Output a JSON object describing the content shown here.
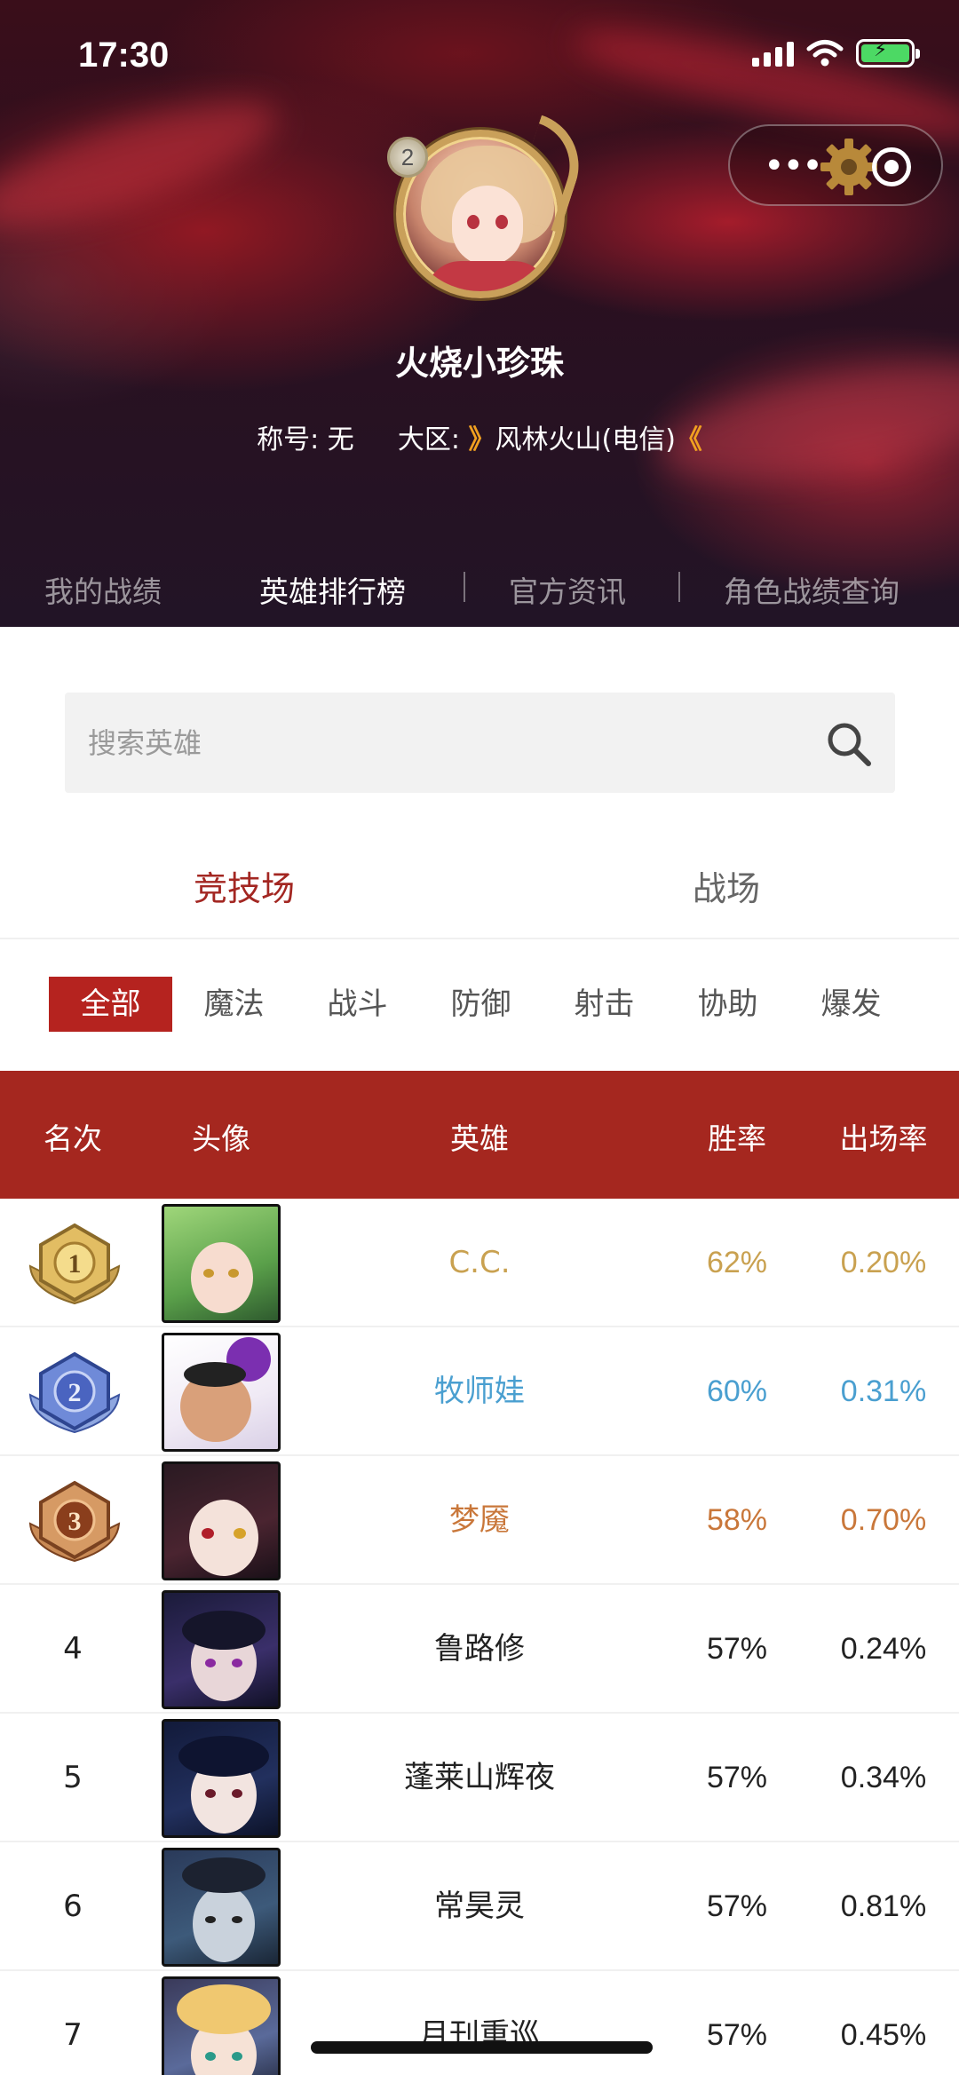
{
  "status": {
    "time": "17:30"
  },
  "profile": {
    "level": "2",
    "name": "火烧小珍珠",
    "title_label": "称号:",
    "title_value": "无",
    "region_label": "大区:",
    "region_arrow_left": "》",
    "region_value": "风林火山(电信)",
    "region_arrow_right": "《"
  },
  "hero_tabs": [
    "我的战绩",
    "英雄排行榜",
    "官方资讯",
    "角色战绩查询"
  ],
  "search": {
    "placeholder": "搜索英雄"
  },
  "mode_tabs": [
    "竞技场",
    "战场"
  ],
  "categories": [
    "全部",
    "魔法",
    "战斗",
    "防御",
    "射击",
    "协助",
    "爆发"
  ],
  "table": {
    "headers": [
      "名次",
      "头像",
      "英雄",
      "胜率",
      "出场率"
    ],
    "rows": [
      {
        "rank": "1",
        "name": "C.C.",
        "win_rate": "62%",
        "pick_rate": "0.20%",
        "color": "#c9a150"
      },
      {
        "rank": "2",
        "name": "牧师娃",
        "win_rate": "60%",
        "pick_rate": "0.31%",
        "color": "#4a9fd0"
      },
      {
        "rank": "3",
        "name": "梦魇",
        "win_rate": "58%",
        "pick_rate": "0.70%",
        "color": "#c9773a"
      },
      {
        "rank": "4",
        "name": "鲁路修",
        "win_rate": "57%",
        "pick_rate": "0.24%",
        "color": "#222222"
      },
      {
        "rank": "5",
        "name": "蓬莱山辉夜",
        "win_rate": "57%",
        "pick_rate": "0.34%",
        "color": "#222222"
      },
      {
        "rank": "6",
        "name": "常昊灵",
        "win_rate": "57%",
        "pick_rate": "0.81%",
        "color": "#222222"
      },
      {
        "rank": "7",
        "name": "月刊重巡",
        "win_rate": "57%",
        "pick_rate": "0.45%",
        "color": "#222222"
      }
    ]
  },
  "colors": {
    "accent": "#a5271f",
    "gold": "#c9a150",
    "silver_blue": "#4a9fd0",
    "bronze": "#c9773a"
  }
}
